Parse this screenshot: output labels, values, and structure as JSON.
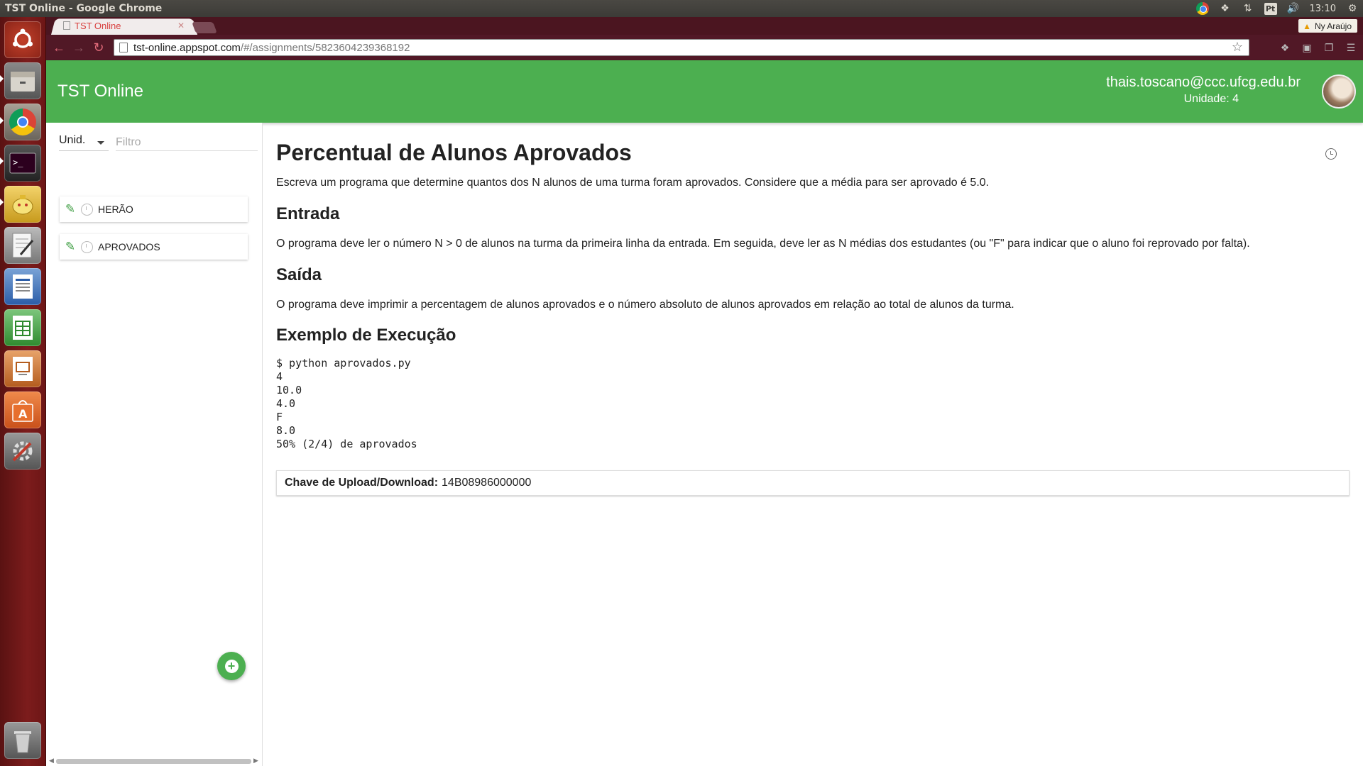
{
  "os": {
    "window_title": "TST Online - Google Chrome",
    "clock": "13:10",
    "lang": "Pt"
  },
  "launcher": {
    "items": [
      "ubuntu-dash",
      "files",
      "chrome",
      "terminal",
      "games",
      "text-editor",
      "writer",
      "calc",
      "impress",
      "software-center",
      "system-settings",
      "trash"
    ]
  },
  "browser": {
    "tab_title": "TST Online",
    "profile_name": "Ny Araújo",
    "url_host": "tst-online.appspot.com",
    "url_path": "/#/assignments/5823604239368192"
  },
  "header": {
    "title": "TST Online",
    "email": "thais.toscano@ccc.ufcg.edu.br",
    "unit": "Unidade: 4"
  },
  "sidebar": {
    "unit_select": "Unid.",
    "filter_placeholder": "Filtro",
    "items": [
      {
        "label": "HERÃO"
      },
      {
        "label": "APROVADOS"
      }
    ]
  },
  "main": {
    "title": "Percentual de Alunos Aprovados",
    "intro": "Escreva um programa que determine quantos dos N alunos de uma turma foram aprovados. Considere que a média para ser aprovado é 5.0.",
    "input_heading": "Entrada",
    "input_text": "O programa deve ler o número N > 0 de alunos na turma da primeira linha da entrada. Em seguida, deve ler as N médias dos estudantes (ou \"F\" para indicar que o aluno foi reprovado por falta).",
    "output_heading": "Saída",
    "output_text": "O programa deve imprimir a percentagem de alunos aprovados e o número absoluto de alunos aprovados em relação ao total de alunos da turma.",
    "example_heading": "Exemplo de Execução",
    "example_code": "$ python aprovados.py\n4\n10.0\n4.0\nF\n8.0\n50% (2/4) de aprovados",
    "upload_label": "Chave de Upload/Download:",
    "upload_key": "14B08986000000"
  },
  "colors": {
    "header_green": "#4caf50",
    "launcher_red": "#7c1c1c",
    "browser_frame": "#511826"
  }
}
